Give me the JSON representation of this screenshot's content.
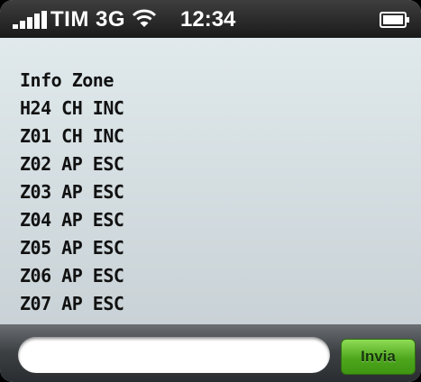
{
  "status_bar": {
    "carrier": "TIM 3G",
    "time": "12:34",
    "icons": [
      "signal-icon",
      "wifi-icon",
      "battery-icon"
    ]
  },
  "messages": [
    "Info Zone",
    "H24 CH INC",
    "Z01 CH INC",
    "Z02 AP ESC",
    "Z03 AP ESC",
    "Z04 AP ESC",
    "Z05 AP ESC",
    "Z06 AP ESC",
    "Z07 AP ESC"
  ],
  "input_bar": {
    "value": "",
    "placeholder": "",
    "send_label": "Invia"
  },
  "colors": {
    "content_background": "#d9e2e6",
    "send_button": "#4ea71d"
  }
}
